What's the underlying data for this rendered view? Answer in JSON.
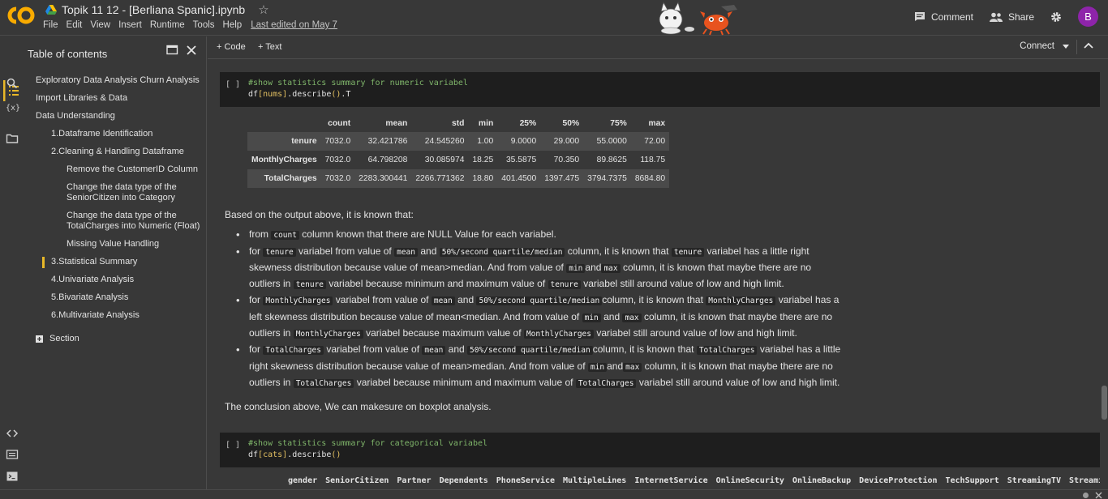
{
  "app": {
    "logo_text": "CO",
    "notebook_title": "Topik 11 12 - [Berliana Spanic].ipynb",
    "menu": [
      "File",
      "Edit",
      "View",
      "Insert",
      "Runtime",
      "Tools",
      "Help"
    ],
    "last_edited": "Last edited on May 7",
    "comment_label": "Comment",
    "share_label": "Share",
    "avatar_letter": "B"
  },
  "toc": {
    "title": "Table of contents",
    "items": [
      {
        "label": "Exploratory Data Analysis Churn Analysis",
        "level": 1
      },
      {
        "label": "Import Libraries & Data",
        "level": 1
      },
      {
        "label": "Data Understanding",
        "level": 1
      },
      {
        "label": "1.Dataframe Identification",
        "level": 2
      },
      {
        "label": "2.Cleaning & Handling Dataframe",
        "level": 2
      },
      {
        "label": "Remove the CustomerID Column",
        "level": 3
      },
      {
        "label": "Change the data type of the SeniorCitizen into Category",
        "level": 3
      },
      {
        "label": "Change the data type of the TotalCharges into Numeric (Float)",
        "level": 3
      },
      {
        "label": "Missing Value Handling",
        "level": 3
      },
      {
        "label": "3.Statistical Summary",
        "level": 2,
        "active": true
      },
      {
        "label": "4.Univariate Analysis",
        "level": 2
      },
      {
        "label": "5.Bivariate Analysis",
        "level": 2
      },
      {
        "label": "6.Multivariate Analysis",
        "level": 2
      }
    ],
    "section_label": "Section"
  },
  "toolbar": {
    "code_label": "+ Code",
    "text_label": "+ Text",
    "connect_label": "Connect"
  },
  "cell1": {
    "run_label": "[ ]",
    "comment": "#show statistics summary for numeric variabel",
    "code_pre": "df",
    "code_mid": "[nums]",
    "code_post": ".describe",
    "code_paren": "()",
    "code_end": ".T"
  },
  "stats_table": {
    "columns": [
      "",
      "count",
      "mean",
      "std",
      "min",
      "25%",
      "50%",
      "75%",
      "max"
    ],
    "rows": [
      {
        "name": "tenure",
        "values": [
          "7032.0",
          "32.421786",
          "24.545260",
          "1.00",
          "9.0000",
          "29.000",
          "55.0000",
          "72.00"
        ]
      },
      {
        "name": "MonthlyCharges",
        "values": [
          "7032.0",
          "64.798208",
          "30.085974",
          "18.25",
          "35.5875",
          "70.350",
          "89.8625",
          "118.75"
        ]
      },
      {
        "name": "TotalCharges",
        "values": [
          "7032.0",
          "2283.300441",
          "2266.771362",
          "18.80",
          "401.4500",
          "1397.475",
          "3794.7375",
          "8684.80"
        ]
      }
    ]
  },
  "markdown": {
    "intro": "Based on the output above, it is known that:",
    "b1_a": "from",
    "b1_code": "count",
    "b1_b": "column known that there are NULL Value for each variabel.",
    "b2_1": "for",
    "b2_c1": "tenure",
    "b2_2": "variabel from value of",
    "b2_c2": "mean",
    "b2_3": "and",
    "b2_c3": "50%/second quartile/median",
    "b2_4": "column, it is known that",
    "b2_c4": "tenure",
    "b2_5": "variabel has a little right skewness distribution because value of mean>median. And from value of",
    "b2_c5": "min",
    "b2_6": "and",
    "b2_c6": "max",
    "b2_7": "column, it is known that maybe there are no outliers in",
    "b2_c7": "tenure",
    "b2_8": "variabel because minimum and maximum value of",
    "b2_c8": "tenure",
    "b2_9": "variabel still around value of low and high limit.",
    "b3_1": "for",
    "b3_c1": "MonthlyCharges",
    "b3_2": "variabel from value of",
    "b3_c2": "mean",
    "b3_3": "and",
    "b3_c3": "50%/second quartile/median",
    "b3_4": "column, it is known that",
    "b3_c4": "MonthlyCharges",
    "b3_5": "variabel has a left skewness distribution because value of mean<median. And from value of",
    "b3_c5": "min",
    "b3_6": "and",
    "b3_c6": "max",
    "b3_7": "column, it is known that maybe there are no outliers in",
    "b3_c7": "MonthlyCharges",
    "b3_8": "variabel because maximum value of",
    "b3_c8": "MonthlyCharges",
    "b3_9": "variabel still around value of low and high limit.",
    "b4_1": "for",
    "b4_c1": "TotalCharges",
    "b4_2": "variabel from value of",
    "b4_c2": "mean",
    "b4_3": "and",
    "b4_c3": "50%/second quartile/median",
    "b4_4": "column, it is known that",
    "b4_c4": "TotalCharges",
    "b4_5": "variabel has a little right skewness distribution because value of mean>median. And from value of",
    "b4_c5": "min",
    "b4_6": "and",
    "b4_c6": "max",
    "b4_7": "column, it is known that maybe there are no outliers in",
    "b4_c7": "TotalCharges",
    "b4_8": "variabel because minimum and maximum value of",
    "b4_c8": "TotalCharges",
    "b4_9": "variabel still around value of low and high limit.",
    "conclusion": "The conclusion above, We can makesure on boxplot analysis."
  },
  "cell2": {
    "run_label": "[ ]",
    "comment": "#show statistics summary for categorical variabel",
    "code_pre": "df",
    "code_mid": "[cats]",
    "code_post": ".describe",
    "code_paren": "()"
  },
  "cat_columns": [
    "gender",
    "SeniorCitizen",
    "Partner",
    "Dependents",
    "PhoneService",
    "MultipleLines",
    "InternetService",
    "OnlineSecurity",
    "OnlineBackup",
    "DeviceProtection",
    "TechSupport",
    "StreamingTV",
    "StreamingMo"
  ],
  "colors": {
    "background": "#383838",
    "cell": "#1e1e1e",
    "accent": "#e8b828",
    "comment": "#7fb56a",
    "avatar": "#8e24aa"
  }
}
